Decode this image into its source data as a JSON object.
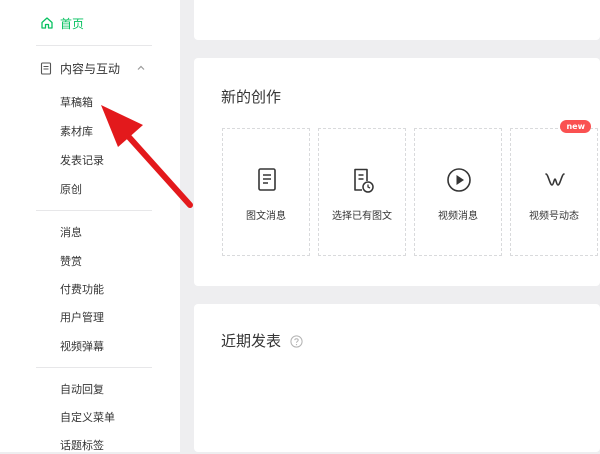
{
  "sidebar": {
    "home_label": "首页",
    "group_label": "内容与互动",
    "group_items": [
      "草稿箱",
      "素材库",
      "发表记录",
      "原创"
    ],
    "section2_items": [
      "消息",
      "赞赏",
      "付费功能",
      "用户管理",
      "视频弹幕"
    ],
    "section3_items": [
      "自动回复",
      "自定义菜单",
      "话题标签"
    ]
  },
  "create": {
    "title": "新的创作",
    "tiles": [
      {
        "label": "图文消息",
        "icon": "document-icon"
      },
      {
        "label": "选择已有图文",
        "icon": "document-history-icon"
      },
      {
        "label": "视频消息",
        "icon": "play-circle-icon"
      },
      {
        "label": "视频号动态",
        "icon": "channels-icon",
        "badge": "new"
      }
    ]
  },
  "recent": {
    "title": "近期发表"
  },
  "colors": {
    "accent": "#07c160",
    "annotation_arrow": "#e3191c",
    "badge": "#fa5151"
  }
}
